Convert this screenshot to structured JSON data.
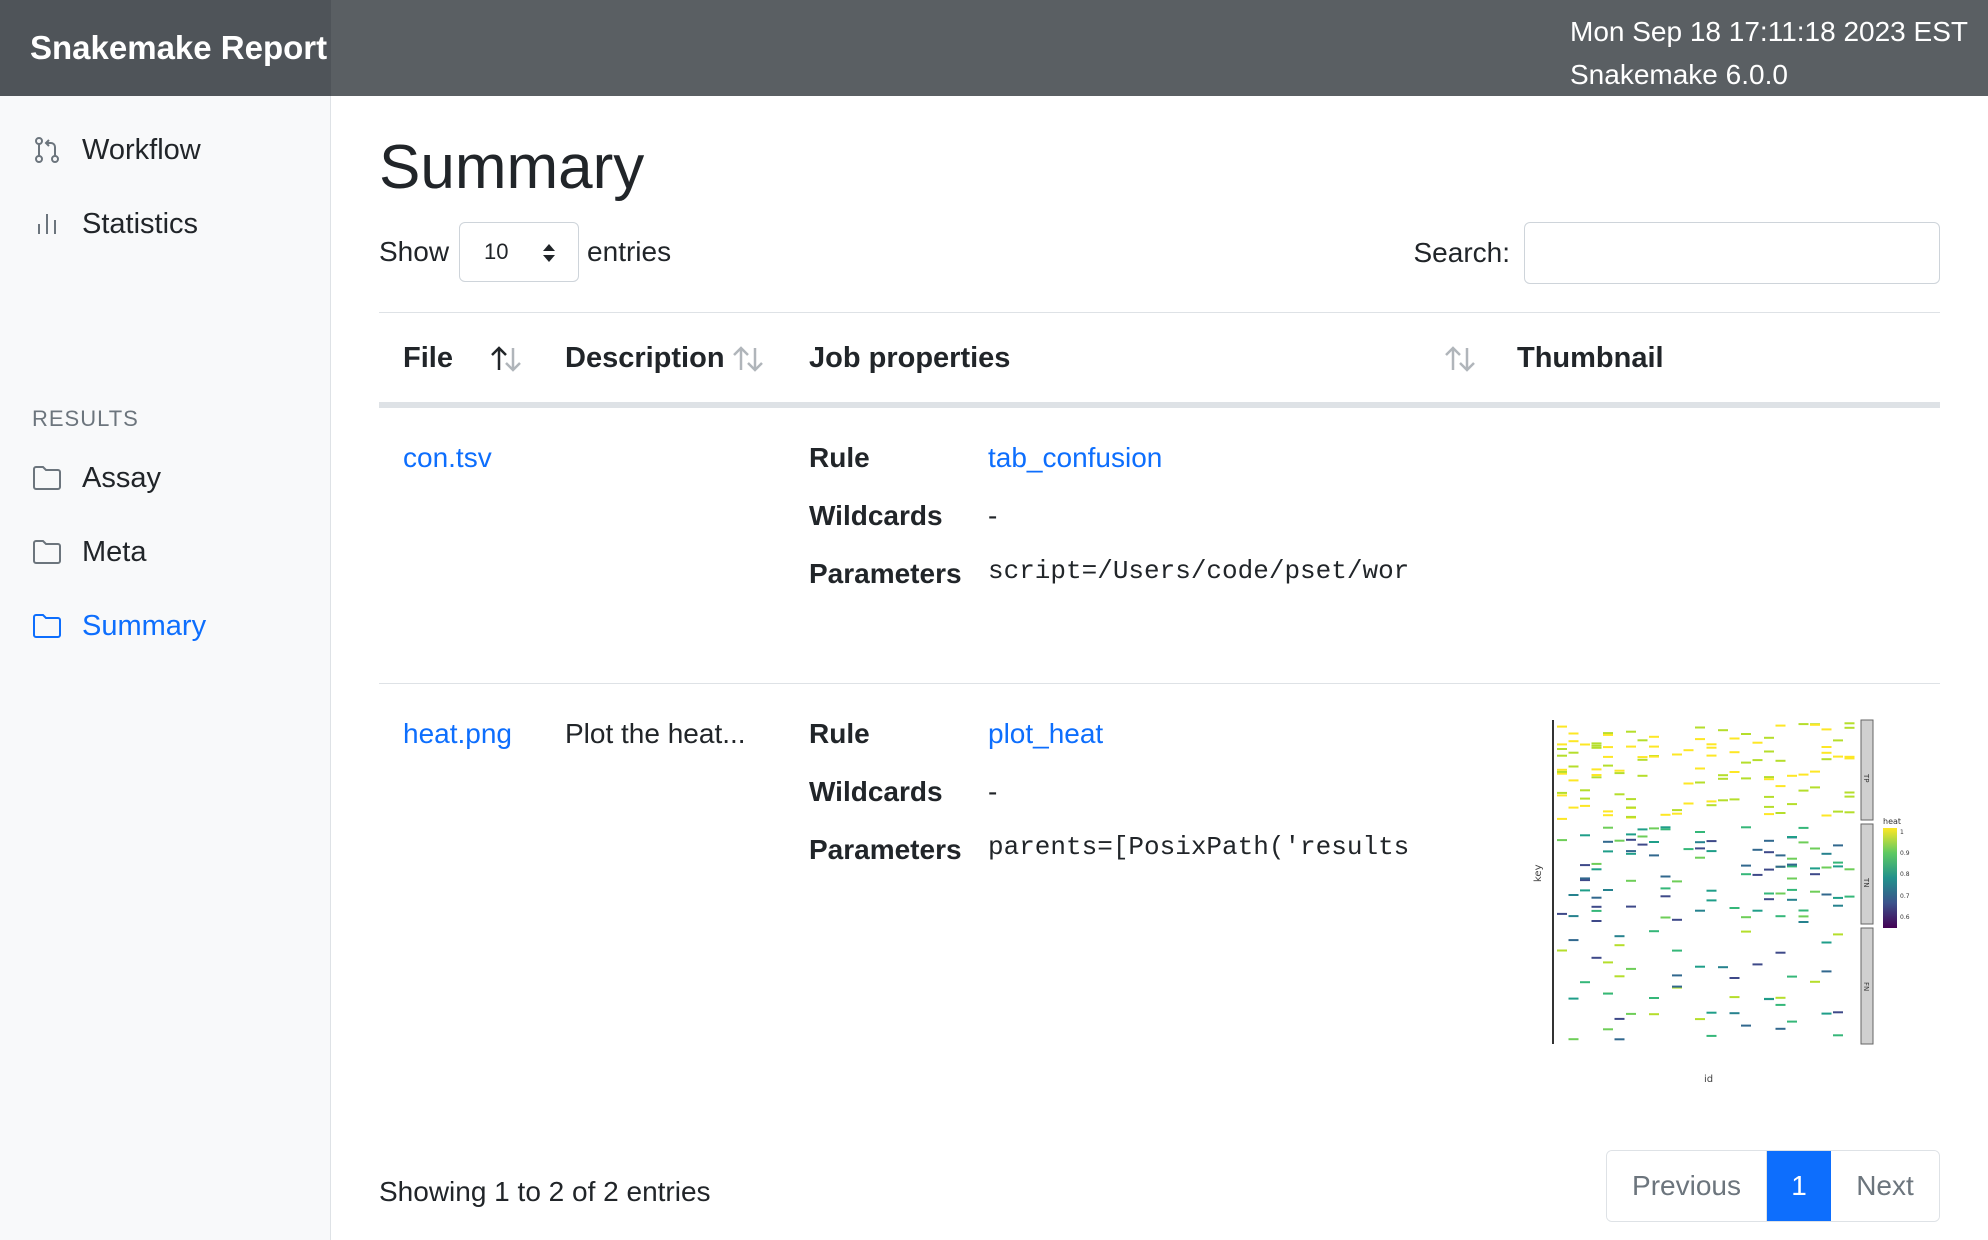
{
  "header": {
    "brand": "Snakemake Report",
    "datetime": "Mon Sep 18 17:11:18 2023 EST",
    "version": "Snakemake 6.0.0"
  },
  "sidebar": {
    "nav": [
      {
        "label": "Workflow",
        "icon": "git-pull-request-icon"
      },
      {
        "label": "Statistics",
        "icon": "bar-chart-icon"
      }
    ],
    "section_label": "RESULTS",
    "results": [
      {
        "label": "Assay",
        "icon": "folder-icon",
        "active": false
      },
      {
        "label": "Meta",
        "icon": "folder-icon",
        "active": false
      },
      {
        "label": "Summary",
        "icon": "folder-icon",
        "active": true
      }
    ]
  },
  "main": {
    "title": "Summary",
    "length_control": {
      "prefix": "Show",
      "value": "10",
      "suffix": "entries"
    },
    "search": {
      "label": "Search:",
      "value": ""
    },
    "columns": [
      "File",
      "Description",
      "Job properties",
      "Thumbnail"
    ],
    "prop_labels": {
      "rule": "Rule",
      "wildcards": "Wildcards",
      "parameters": "Parameters"
    },
    "rows": [
      {
        "file": "con.tsv",
        "description": "",
        "rule": "tab_confusion",
        "wildcards": "-",
        "parameters": "script=/Users/code/pset/wor",
        "has_thumbnail": false
      },
      {
        "file": "heat.png",
        "description": "Plot the heat...",
        "rule": "plot_heat",
        "wildcards": "-",
        "parameters": "parents=[PosixPath('results",
        "has_thumbnail": true,
        "thumbnail": {
          "ylabel": "key",
          "xlabel": "id",
          "legend_title": "heat",
          "legend_ticks": [
            "1",
            "0.9",
            "0.8",
            "0.7",
            "0.6"
          ],
          "facets": [
            "TP",
            "TN",
            "FN"
          ]
        }
      }
    ],
    "info": "Showing 1 to 2 of 2 entries",
    "pagination": {
      "previous": "Previous",
      "current": "1",
      "next": "Next"
    }
  },
  "colors": {
    "header_bg": "#5a5f63",
    "brand_bg": "#4f5459",
    "link": "#0d6efd",
    "sidebar_bg": "#f8f9fa"
  }
}
